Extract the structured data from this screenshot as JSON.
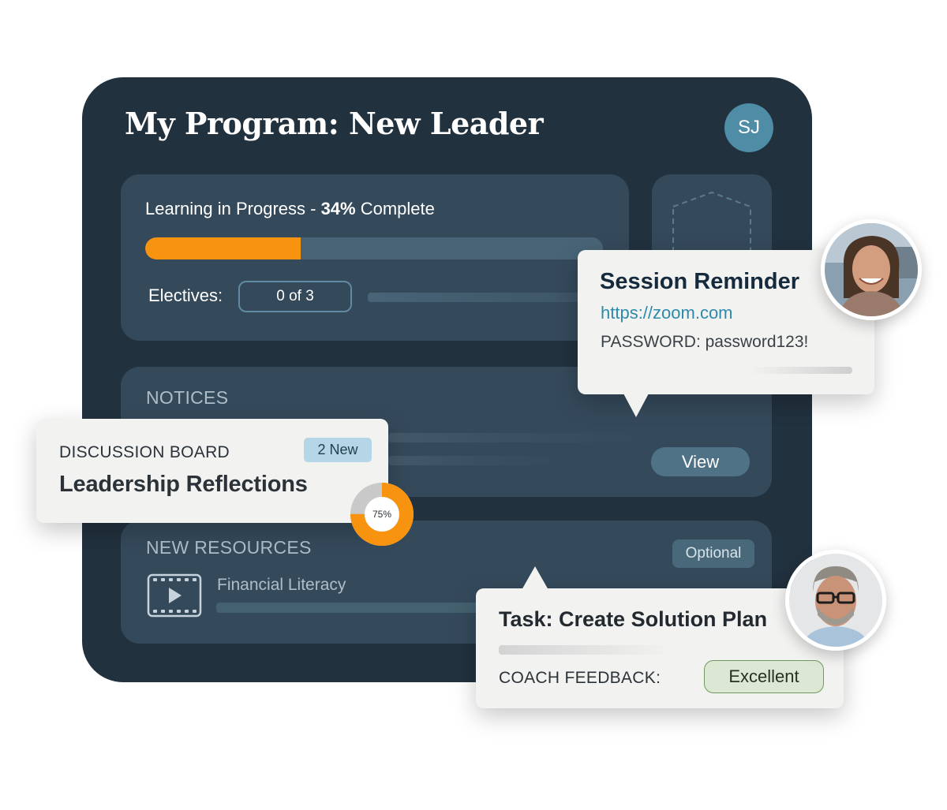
{
  "program": {
    "title": "My Program: New Leader",
    "avatar_initials": "SJ"
  },
  "progress": {
    "label_prefix": "Learning in Progress - ",
    "percent_label": "34%",
    "label_suffix": " Complete",
    "percent_value": 0.34,
    "electives_label": "Electives:",
    "electives_value": "0 of 3"
  },
  "notices": {
    "heading": "NOTICES",
    "view_label": "View"
  },
  "resources": {
    "heading": "NEW RESOURCES",
    "optional_label": "Optional",
    "item_title": "Financial Literacy",
    "item_icon": "video-icon"
  },
  "discussion": {
    "label": "DISCUSSION BOARD",
    "badge": "2 New",
    "title": "Leadership Reflections",
    "completion_label": "75%",
    "completion_value": 0.75
  },
  "reminder": {
    "title": "Session Reminder",
    "link": "https://zoom.com",
    "password": "PASSWORD: password123!"
  },
  "task": {
    "title": "Task: Create Solution Plan",
    "feedback_label": "COACH FEEDBACK:",
    "feedback_value": "Excellent"
  },
  "colors": {
    "card_bg": "#22313e",
    "panel_bg": "#34495a",
    "accent_orange": "#f7930f",
    "avatar_blue": "#4f8da6",
    "link_blue": "#2d8aab",
    "excellent_green": "#dce8d3"
  }
}
